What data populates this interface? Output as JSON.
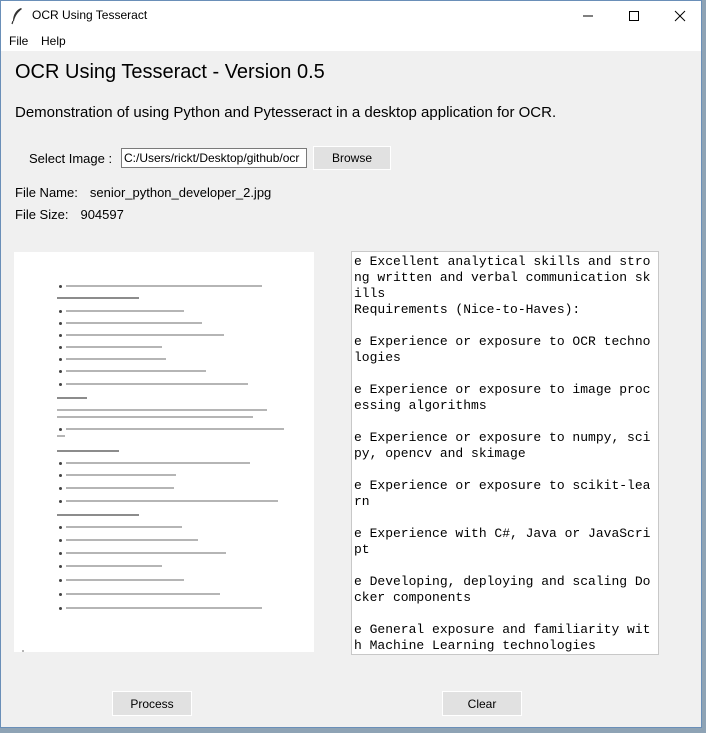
{
  "window": {
    "title": "OCR Using Tesseract",
    "icon": "feather-icon",
    "controls": [
      "minimize-icon",
      "maximize-icon",
      "close-icon"
    ]
  },
  "menu": {
    "file": "File",
    "help": "Help"
  },
  "heading": "OCR Using Tesseract - Version 0.5",
  "description": "Demonstration of using Python and Pytesseract in a desktop application for OCR.",
  "select": {
    "label": "Select Image :",
    "path_value": "C:/Users/rickt/Desktop/github/ocr",
    "browse_label": "Browse"
  },
  "file_info": {
    "name_label": "File Name:",
    "name_value": "senior_python_developer_2.jpg",
    "size_label": "File Size:",
    "size_value": "904597"
  },
  "ocr_text": "e Excellent analytical skills and stro\nng written and verbal communication sk\nills\nRequirements (Nice-to-Haves):\n\ne Experience or exposure to OCR techno\nlogies\n\ne Experience or exposure to image proc\nessing algorithms\n\ne Experience or exposure to numpy, sci\npy, opencv and skimage\n\ne Experience or exposure to scikit-lea\nrn\n\ne Experience with C#, Java or JavaScri\npt\n\ne Developing, deploying and scaling Do\ncker components\n\ne General exposure and familiarity wit\nh Machine Learning technologies",
  "buttons": {
    "process": "Process",
    "clear": "Clear"
  }
}
